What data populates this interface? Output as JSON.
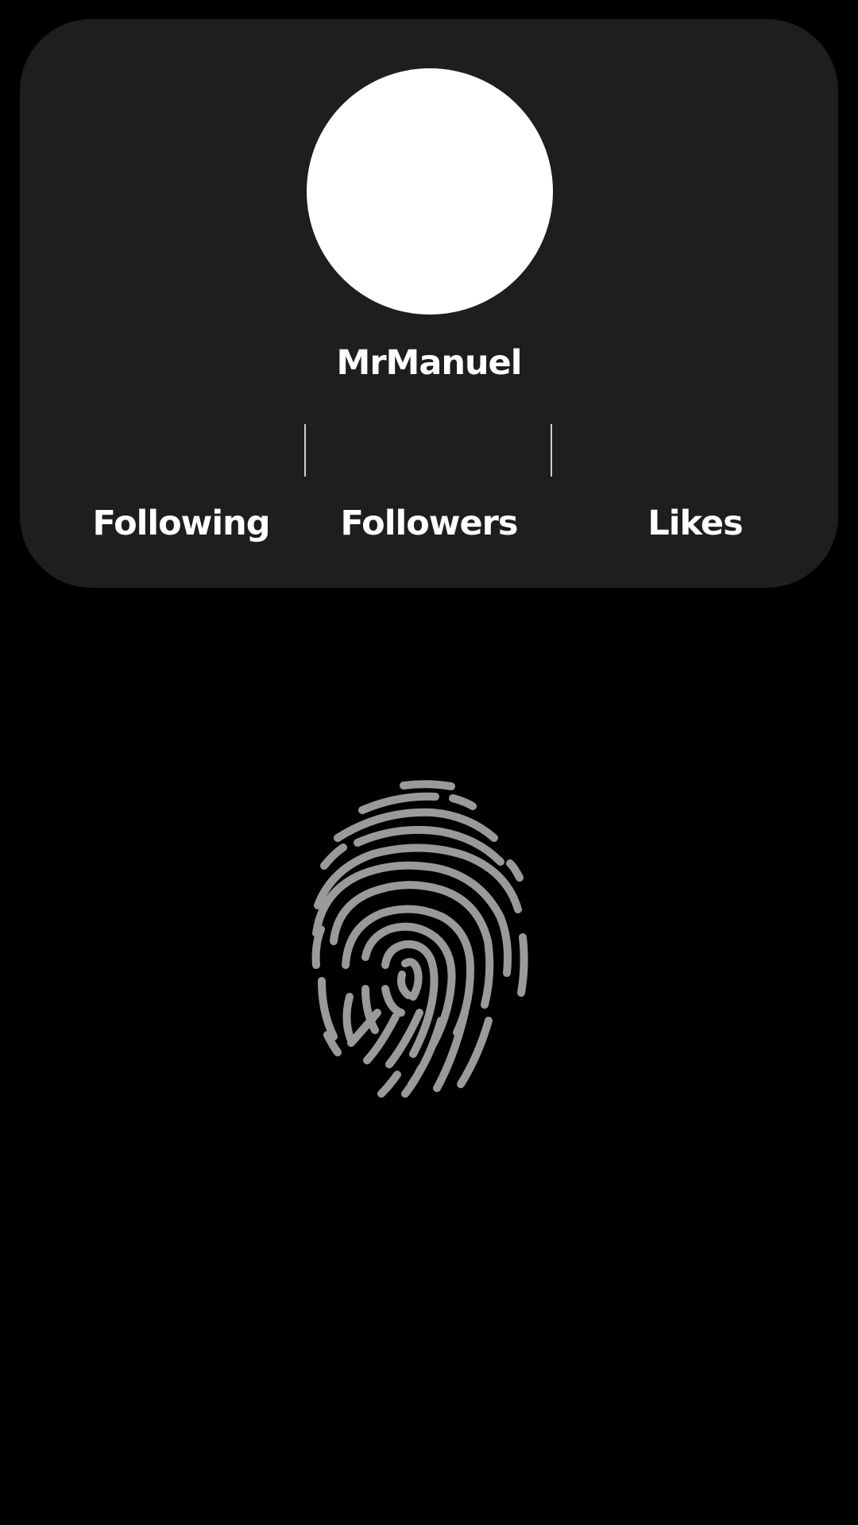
{
  "profile": {
    "username": "MrManuel",
    "stats": {
      "following_label": "Following",
      "followers_label": "Followers",
      "likes_label": "Likes"
    }
  },
  "icons": {
    "fingerprint": "fingerprint-icon"
  },
  "colors": {
    "background": "#000000",
    "card": "#1e1e1e",
    "text": "#ffffff",
    "fingerprint": "#9a9a9a"
  }
}
